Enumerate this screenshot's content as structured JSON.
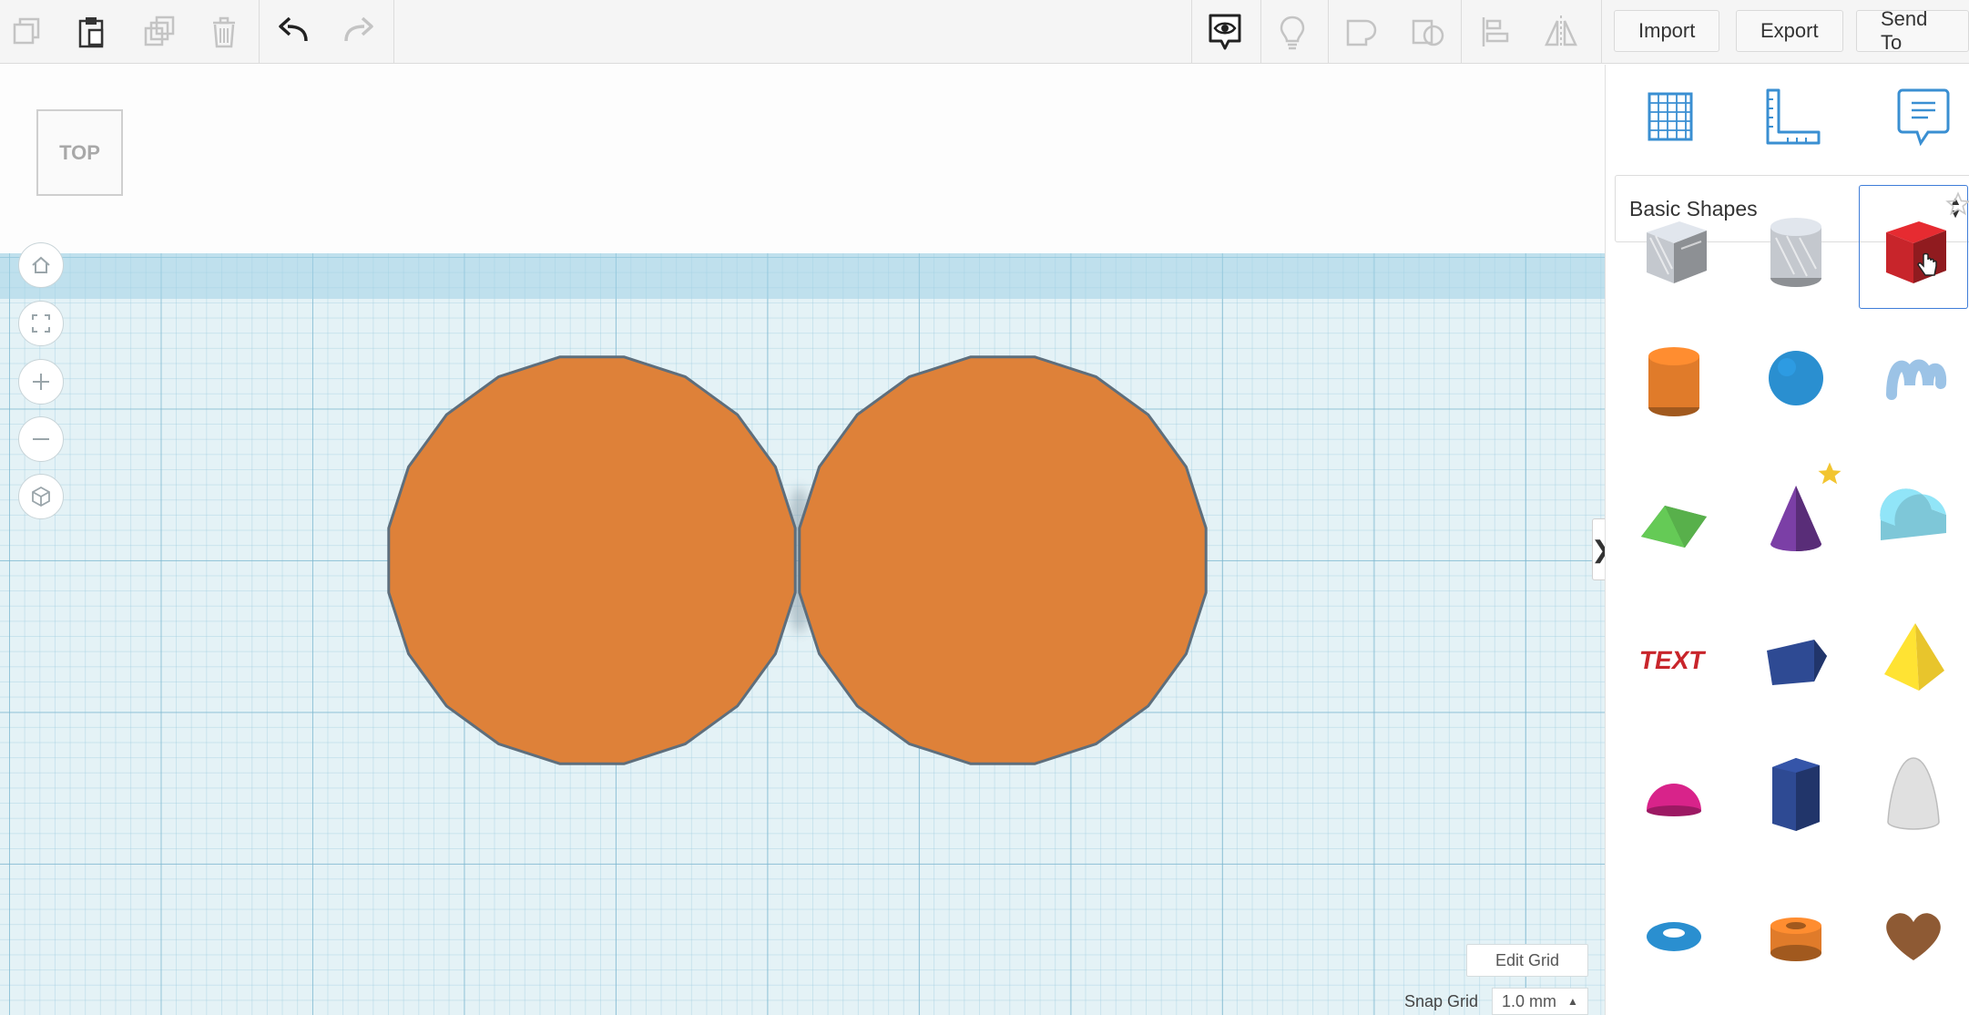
{
  "toolbar": {
    "left_icons": [
      "copy-icon",
      "paste-icon",
      "duplicate-icon",
      "delete-icon",
      "undo-icon",
      "redo-icon"
    ],
    "right_icons": [
      "visibility-icon",
      "lightbulb-icon",
      "group-icon",
      "ungroup-icon",
      "align-icon",
      "mirror-icon"
    ],
    "import_label": "Import",
    "export_label": "Export",
    "send_to_label": "Send To"
  },
  "viewport": {
    "view_cube_label": "TOP",
    "nav_icons": [
      "home-icon",
      "fit-view-icon",
      "zoom-in-icon",
      "zoom-out-icon",
      "perspective-icon"
    ],
    "shapes": [
      {
        "name": "cylinder-left",
        "color": "#de8139",
        "outline": "#5e6e7c"
      },
      {
        "name": "cylinder-right",
        "color": "#de8139",
        "outline": "#5e6e7c"
      }
    ],
    "edit_grid_label": "Edit Grid",
    "snap_grid_label": "Snap Grid",
    "snap_grid_value": "1.0 mm",
    "grid_color": "#e4f2f6"
  },
  "panel": {
    "toggle_glyph": "❯",
    "top_icons": [
      "workplane-icon",
      "ruler-icon",
      "notes-icon"
    ],
    "category": "Basic Shapes",
    "accent": "#3a8fd2",
    "shapes": [
      {
        "name": "box-hole",
        "color": "#c4c8ce"
      },
      {
        "name": "cylinder-hole",
        "color": "#c4c8ce"
      },
      {
        "name": "box",
        "color": "#c8252b",
        "selected": true
      },
      {
        "name": "cylinder",
        "color": "#e07b2a"
      },
      {
        "name": "sphere",
        "color": "#2a8fd0"
      },
      {
        "name": "scribble",
        "color": "#9cc3e6"
      },
      {
        "name": "roof",
        "color": "#58b04b"
      },
      {
        "name": "cone",
        "color": "#7b3fa6",
        "starred": true
      },
      {
        "name": "round-roof",
        "color": "#7ec7d8"
      },
      {
        "name": "text",
        "color": "#c8252b"
      },
      {
        "name": "polygon",
        "color": "#2e4a93"
      },
      {
        "name": "pyramid",
        "color": "#e8c52c"
      },
      {
        "name": "half-sphere",
        "color": "#d8238a"
      },
      {
        "name": "hexagonal-prism",
        "color": "#2e4a93"
      },
      {
        "name": "paraboloid",
        "color": "#e0e0e0"
      },
      {
        "name": "torus",
        "color": "#2a8fd0"
      },
      {
        "name": "tube",
        "color": "#e07b2a"
      },
      {
        "name": "heart",
        "color": "#8e5a34"
      }
    ]
  }
}
